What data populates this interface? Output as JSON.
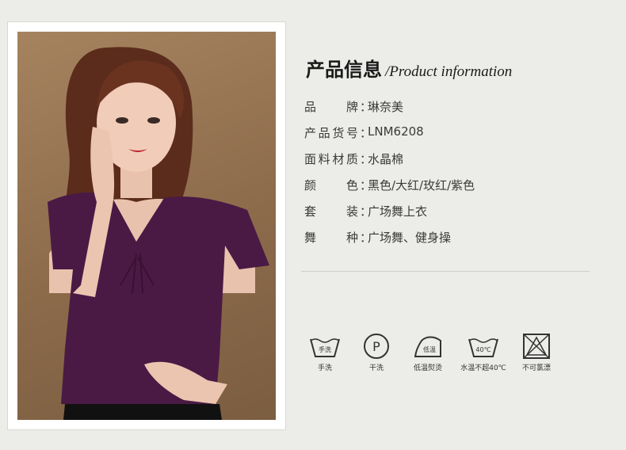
{
  "header": {
    "title_cn": "产品信息",
    "title_en": "/Product information"
  },
  "specs": [
    {
      "label": "品牌",
      "value": "琳奈美"
    },
    {
      "label": "产品货号",
      "value": "LNM6208"
    },
    {
      "label": "面料材质",
      "value": "水晶棉"
    },
    {
      "label": "颜色",
      "value": "黑色/大红/玫红/紫色"
    },
    {
      "label": "套装",
      "value": "广场舞上衣"
    },
    {
      "label": "舞种",
      "value": "广场舞、健身操"
    }
  ],
  "separator": "：",
  "care": [
    {
      "icon": "hand-wash-icon",
      "label": "手洗",
      "tag": "手洗"
    },
    {
      "icon": "dry-clean-icon",
      "label": "干洗",
      "tag": "P"
    },
    {
      "icon": "low-iron-icon",
      "label": "低温熨烫",
      "tag": "低温"
    },
    {
      "icon": "wash-40-icon",
      "label": "水温不超40℃",
      "tag": "40℃"
    },
    {
      "icon": "no-bleach-icon",
      "label": "不可氯漂"
    }
  ],
  "colors": {
    "background": "#ecede8",
    "garment": "#4a1a45",
    "text": "#333333"
  }
}
